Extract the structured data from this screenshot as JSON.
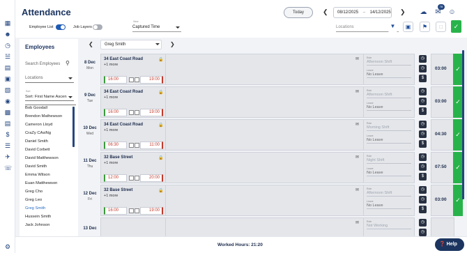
{
  "app": {
    "title": "Attendance"
  },
  "sidebar": {
    "icons": [
      "dashboard-icon",
      "people-icon",
      "clock-icon",
      "org-chart-icon",
      "document-icon",
      "calendar-icon",
      "location-pin-icon",
      "buildings-icon",
      "report-icon",
      "dollar-icon",
      "list-icon",
      "flight-icon",
      "phone-icon"
    ],
    "settings_icon": "gear-icon"
  },
  "header": {
    "today_label": "Today",
    "date_from": "08/12/2025",
    "date_to": "14/12/2025",
    "date_separator": "–",
    "notification_count": "78"
  },
  "filters": {
    "employee_list_label": "Employee List",
    "employee_list_on": true,
    "job_layers_label": "Job Layers",
    "job_layers_on": false,
    "view_label": "View",
    "view_value": "Captured Time",
    "locations_placeholder": "Locations"
  },
  "employees_panel": {
    "title": "Employees",
    "search_placeholder": "Search Employees",
    "locations_placeholder": "Locations",
    "sort_label": "Sort",
    "sort_value": "Sort: First Name Ascen",
    "items": [
      "Bob Goodall",
      "Brendon Mathewson",
      "Cameron Lloyd",
      "CraZy CAsiNg",
      "Daniel Smith",
      "David Corbett",
      "David Matthewson",
      "David Smith",
      "Emma Wilson",
      "Euan Matthewson",
      "Greg Cho",
      "Greg Leo",
      "Greg Smith",
      "Hussein Smith",
      "Jack Johnson"
    ],
    "selected": "Greg Smith"
  },
  "schedule": {
    "employee": "Greg Smith",
    "days": [
      {
        "date": "8 Dec",
        "weekday": "Mon",
        "site": "34 East Coast Road",
        "more": "+1 more",
        "start": "16:00",
        "end": "19:00",
        "role_label": "Role",
        "role": "Afternoon Shift",
        "leave_label": "Leave",
        "leave": "No Leave",
        "hours": "03:00"
      },
      {
        "date": "9 Dec",
        "weekday": "Tue",
        "site": "34 East Coast Road",
        "more": "+1 more",
        "start": "16:00",
        "end": "19:00",
        "role_label": "Role",
        "role": "Afternoon Shift",
        "leave_label": "Leave",
        "leave": "No Leave",
        "hours": "03:00"
      },
      {
        "date": "10 Dec",
        "weekday": "Wed",
        "site": "34 East Coast Road",
        "more": "+1 more",
        "start": "06:30",
        "end": "11:00",
        "role_label": "Role",
        "role": "Morning Shift",
        "leave_label": "Leave",
        "leave": "No Leave",
        "hours": "04:30"
      },
      {
        "date": "11 Dec",
        "weekday": "Thu",
        "site": "32 Base Street",
        "more": "+1 more",
        "start": "12:00",
        "end": "20:00",
        "role_label": "Role",
        "role": "Night Shift",
        "leave_label": "Leave",
        "leave": "No Leave",
        "hours": "07:50"
      },
      {
        "date": "12 Dec",
        "weekday": "Fri",
        "site": "32 Base Street",
        "more": "+1 more",
        "start": "16:00",
        "end": "19:00",
        "role_label": "Role",
        "role": "Afternoon Shift",
        "leave_label": "Leave",
        "leave": "No Leave",
        "hours": "03:00"
      },
      {
        "date": "13 Dec",
        "weekday": "",
        "site": "",
        "more": "",
        "start": "",
        "end": "",
        "role_label": "Role",
        "role": "Not Working",
        "leave_label": "",
        "leave": "",
        "hours": ""
      }
    ]
  },
  "footer": {
    "worked_hours": "Worked Hours: 21:20",
    "help_label": "Help"
  },
  "colors": {
    "primary": "#1c3560",
    "approve": "#28b34a",
    "start_bar": "#3a9a3a",
    "end_bar": "#c0392b"
  }
}
